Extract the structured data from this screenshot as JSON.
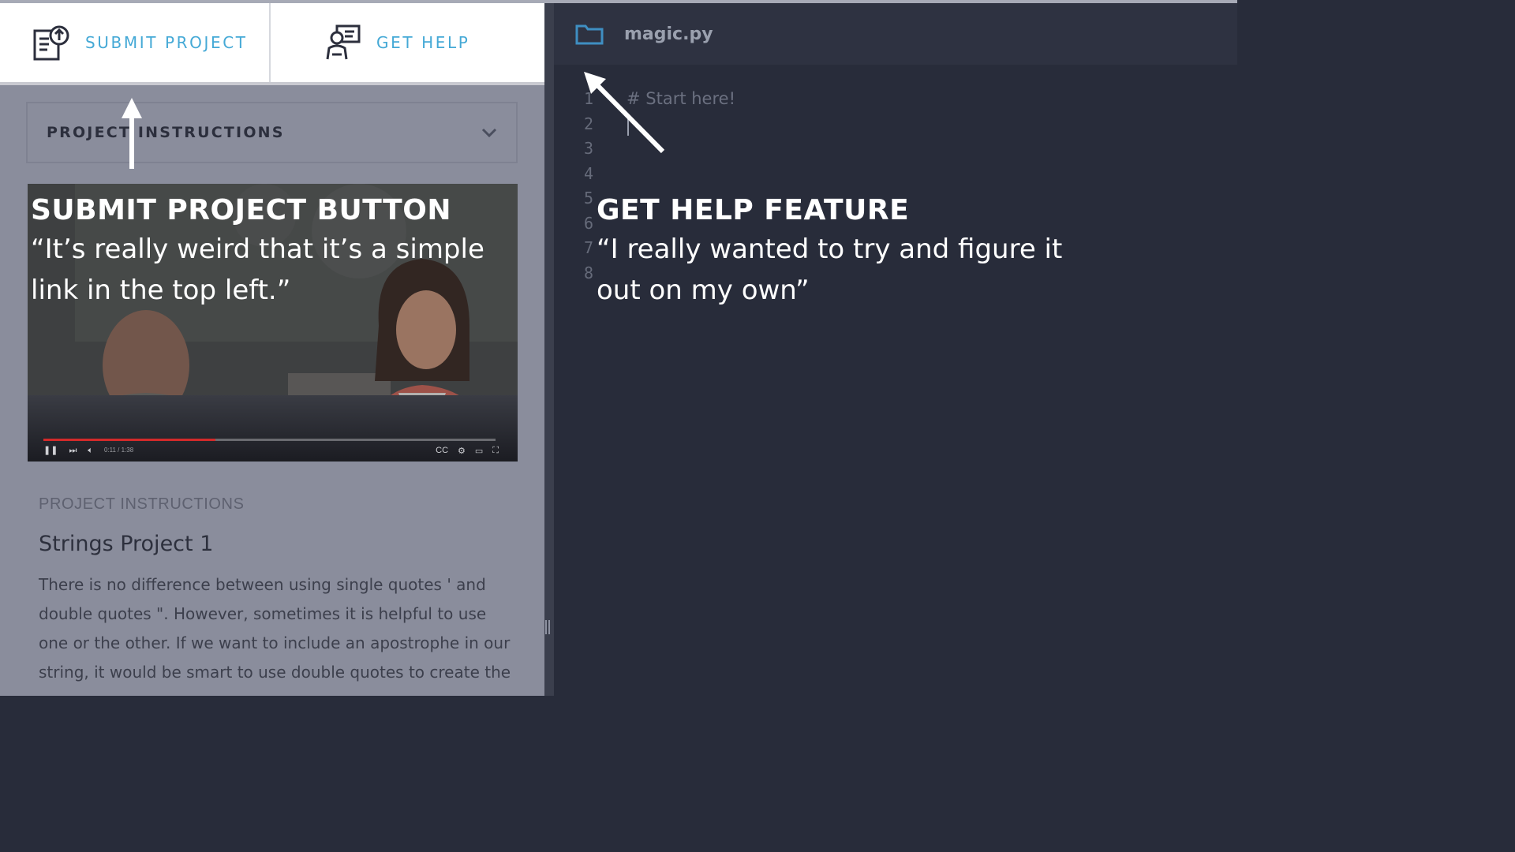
{
  "toolbar": {
    "submit_label": "SUBMIT PROJECT",
    "help_label": "GET HELP"
  },
  "accordion": {
    "label": "PROJECT INSTRUCTIONS",
    "icon": "chevron-down-icon"
  },
  "video": {
    "time": "0:11 / 1:38",
    "progress": 0.38
  },
  "annotations": {
    "submit": {
      "title": "SUBMIT PROJECT BUTTON",
      "quote": "“It’s really weird that it’s a simple link in the top left.”"
    },
    "help": {
      "title": "GET HELP FEATURE",
      "quote": "“I really wanted to try and figure it out on my own”"
    }
  },
  "instructions": {
    "heading": "PROJECT INSTRUCTIONS",
    "title": "Strings Project 1",
    "body": "There is no difference between using single quotes ' and double quotes \". However, sometimes it is helpful to use one or the other. If we want to include an apostrophe in our string, it would be smart to use double quotes to create the"
  },
  "editor": {
    "file_name": "magic.py",
    "line_numbers": [
      "1",
      "2",
      "3",
      "4",
      "5",
      "6",
      "7",
      "8"
    ],
    "code_line_1": "# Start here!"
  },
  "colors": {
    "accent": "#45a9d6",
    "editor_bg": "#282c3a",
    "panel_overlay": "#8a8d9c"
  }
}
